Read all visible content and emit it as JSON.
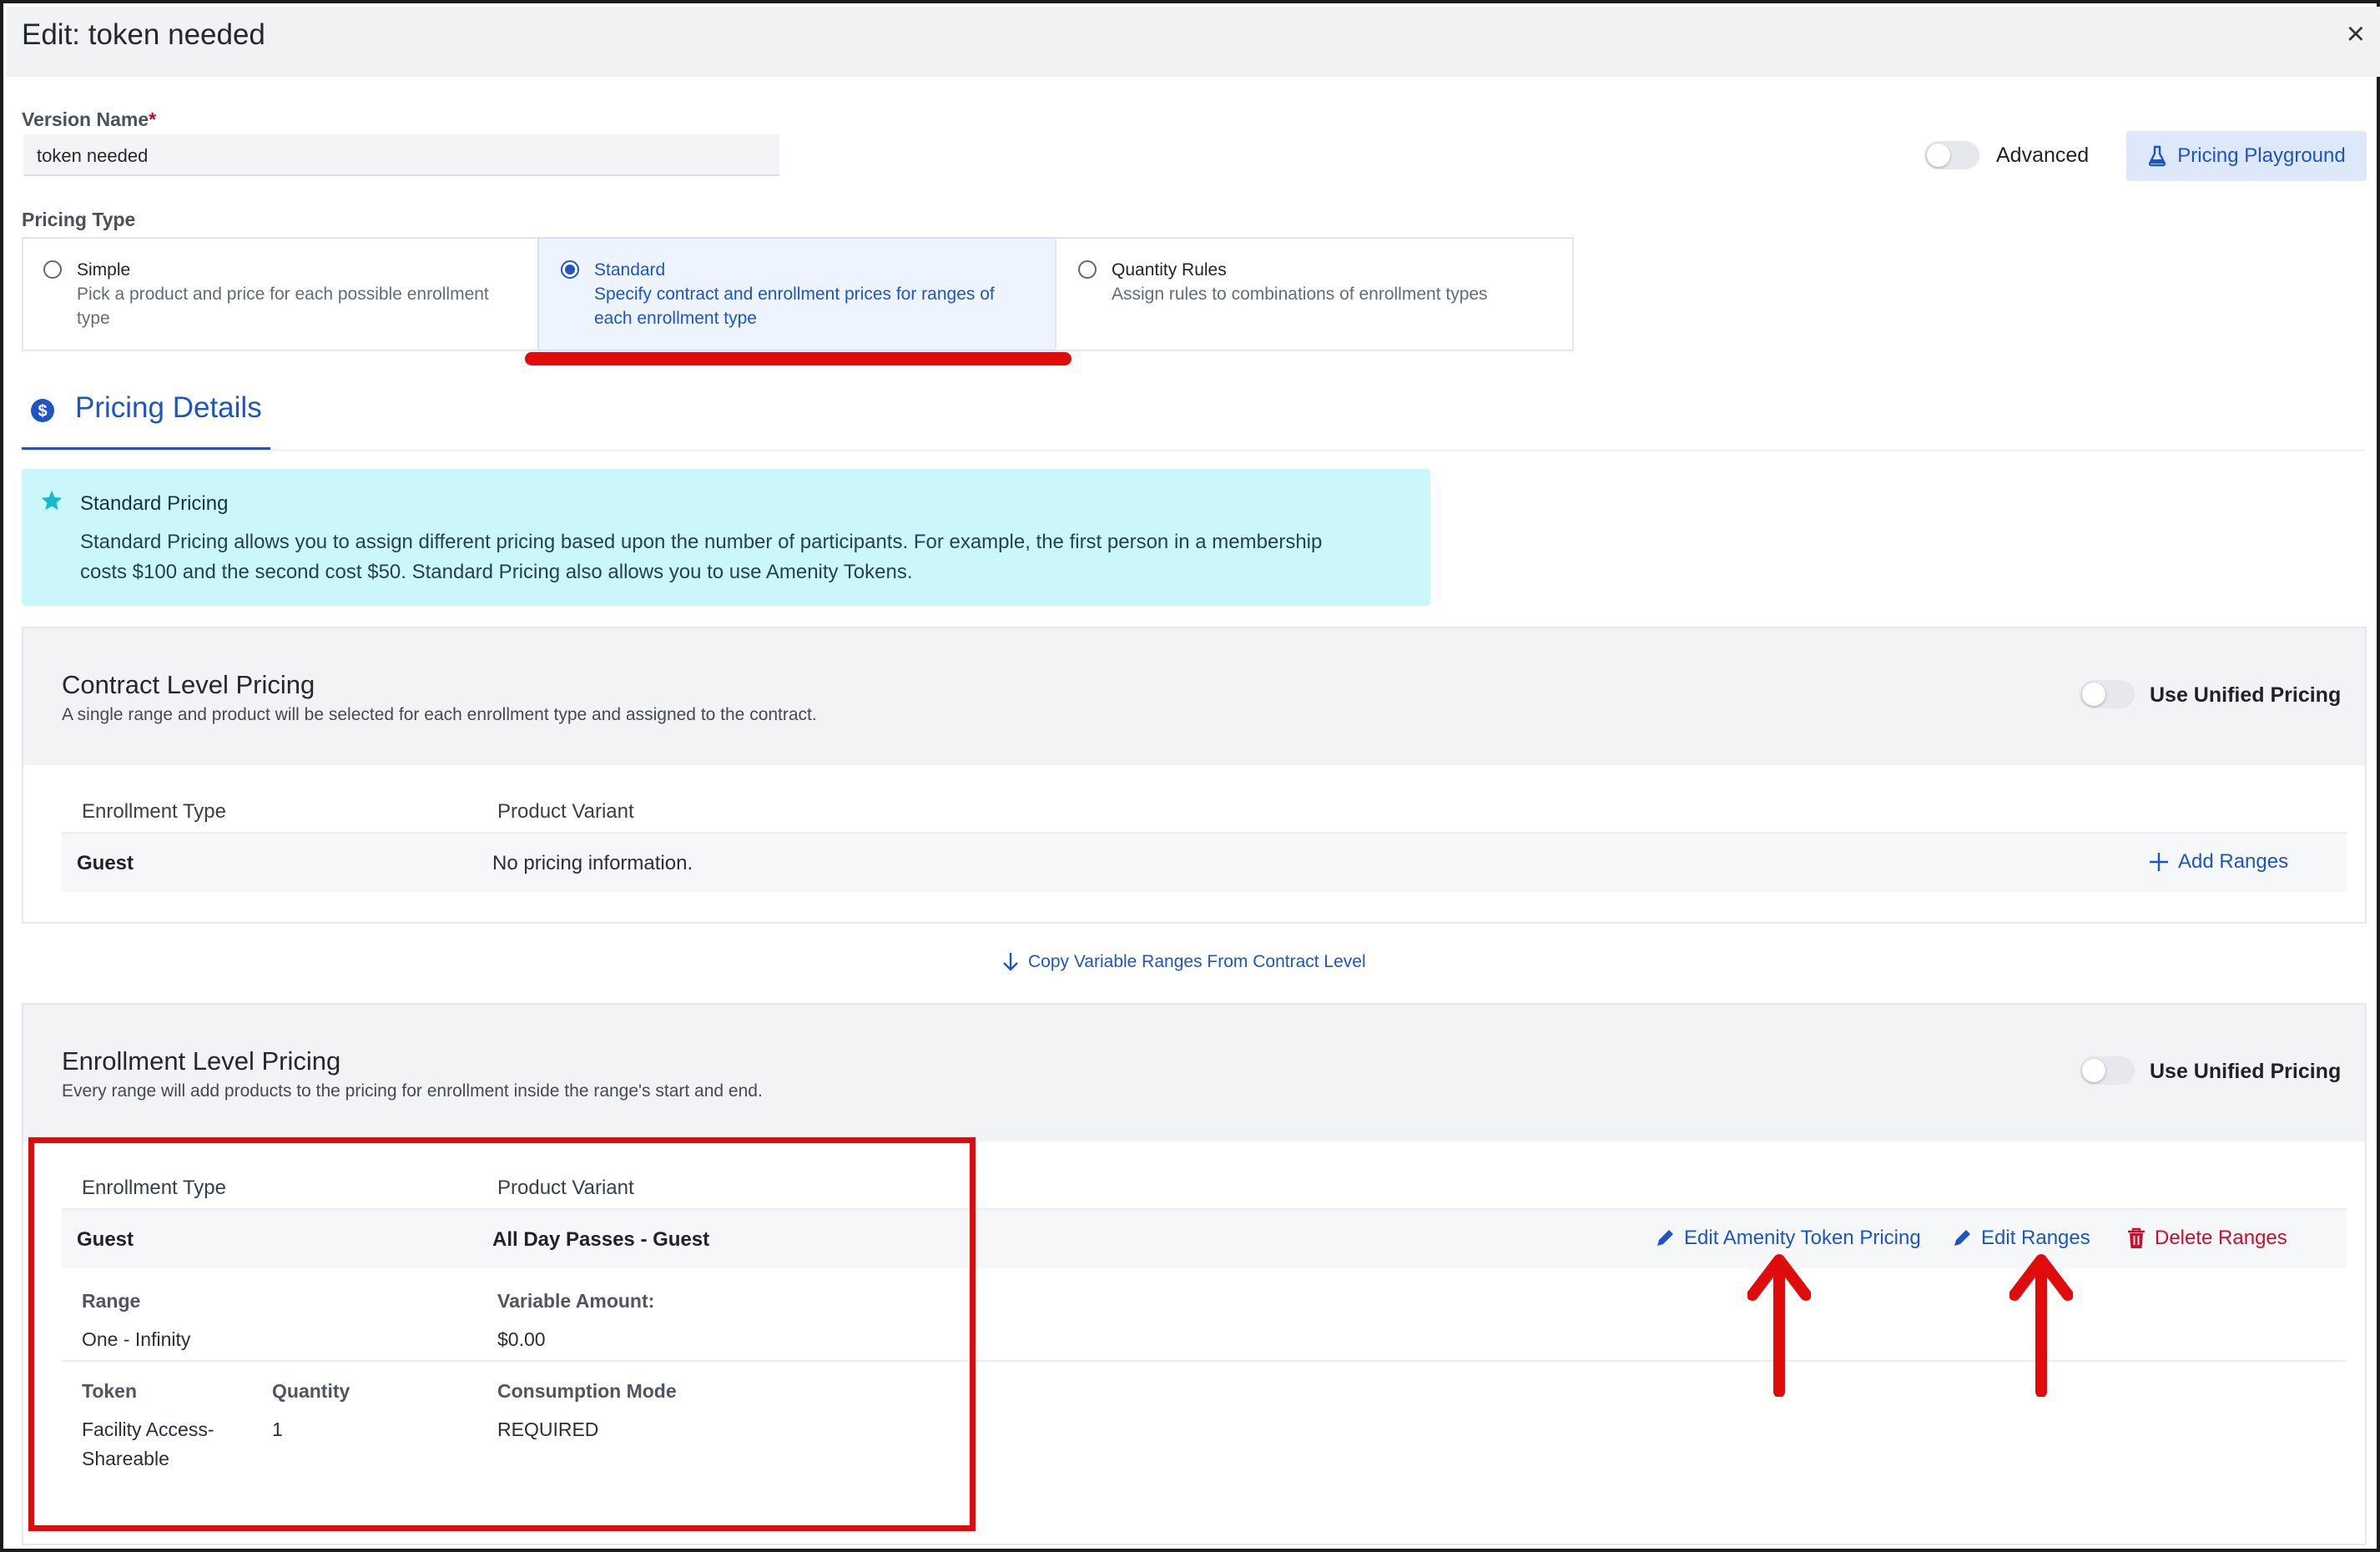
{
  "dialog": {
    "title": "Edit: token needed",
    "close": "×"
  },
  "version": {
    "label": "Version Name",
    "required_mark": "*",
    "value": "token needed"
  },
  "header_controls": {
    "advanced_label": "Advanced",
    "playground_label": "Pricing Playground"
  },
  "pricing_type": {
    "label": "Pricing Type",
    "options": [
      {
        "title": "Simple",
        "desc1": "Pick a product and price for each possible enrollment",
        "desc2": "type",
        "selected": false
      },
      {
        "title": "Standard",
        "desc1": "Specify contract and enrollment prices for ranges of",
        "desc2": "each enrollment type",
        "selected": true
      },
      {
        "title": "Quantity Rules",
        "desc1": "Assign rules to combinations of enrollment types",
        "desc2": "",
        "selected": false
      }
    ]
  },
  "details_tab": {
    "label": "Pricing Details"
  },
  "callout": {
    "title": "Standard Pricing",
    "line1": "Standard Pricing allows you to assign different pricing based upon the number of participants. For example, the first person in a membership",
    "line2": "costs $100 and the second cost $50. Standard Pricing also allows you to use Amenity Tokens."
  },
  "contract": {
    "title": "Contract Level Pricing",
    "subtitle": "A single range and product will be selected for each enrollment type and assigned to the contract.",
    "unified_label": "Use Unified Pricing",
    "col_type": "Enrollment Type",
    "col_variant": "Product Variant",
    "row_type": "Guest",
    "row_variant": "No pricing information.",
    "add_ranges": "Add Ranges"
  },
  "copy_link": "Copy Variable Ranges From Contract Level",
  "enrollment": {
    "title": "Enrollment Level Pricing",
    "subtitle": "Every range will add products to the pricing for enrollment inside the range's start and end.",
    "unified_label": "Use Unified Pricing",
    "col_type": "Enrollment Type",
    "col_variant": "Product Variant",
    "row_type": "Guest",
    "row_variant": "All Day Passes - Guest",
    "edit_token": "Edit Amenity Token Pricing",
    "edit_ranges": "Edit Ranges",
    "delete_ranges": "Delete Ranges",
    "range_label": "Range",
    "range_value": "One - Infinity",
    "amount_label": "Variable Amount:",
    "amount_value": "$0.00",
    "token_label": "Token",
    "token_value_1": "Facility Access-",
    "token_value_2": "Shareable",
    "quantity_label": "Quantity",
    "quantity_value": "1",
    "mode_label": "Consumption Mode",
    "mode_value": "REQUIRED"
  },
  "colors": {
    "accent": "#1d55c4",
    "danger": "#c8102e",
    "annotation": "#e00b0b",
    "callout_bg": "#cbf7fa"
  }
}
